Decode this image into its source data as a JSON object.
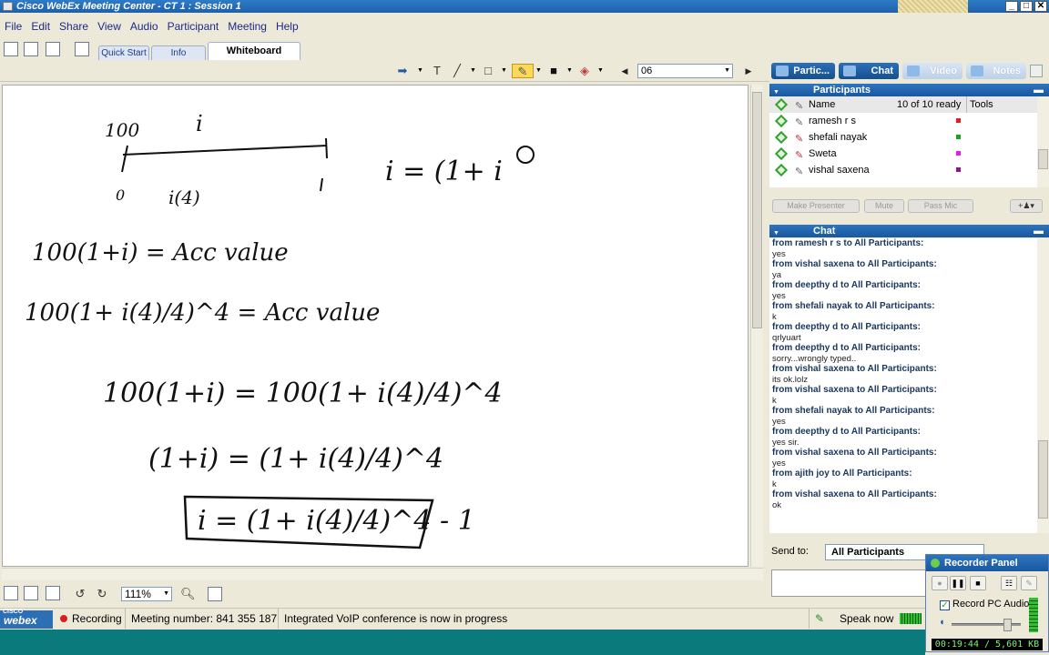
{
  "window": {
    "title": "Cisco WebEx Meeting Center - CT 1 : Session 1",
    "min_label": "_",
    "max_label": "□",
    "close_label": "✕"
  },
  "menu": [
    "File",
    "Edit",
    "Share",
    "View",
    "Audio",
    "Participant",
    "Meeting",
    "Help"
  ],
  "tabs": [
    "Quick Start",
    "Info",
    "Whiteboard"
  ],
  "annotation_toolbar": {
    "text_tool": "T",
    "page": "06"
  },
  "whiteboard": {
    "lines": [
      "100",
      "i",
      "0",
      "1",
      "i(4)",
      "i = (1+ i",
      "100(1+i) = Acc value",
      "100(1+ i(4)/4)^4 = Acc value",
      "100(1+i) = 100(1+ i(4)/4)^4",
      "(1+i) = (1+ i(4)/4)^4",
      "i = (1+ i(4)/4)^4 - 1"
    ]
  },
  "bottom_toolbar": {
    "zoom": "111%"
  },
  "panel_tabs": [
    "Partic...",
    "Chat",
    "Video",
    "Notes"
  ],
  "participants": {
    "header": "Participants",
    "columns": {
      "name": "Name",
      "ready": "10 of 10 ready",
      "tools": "Tools"
    },
    "rows": [
      {
        "name": "ramesh r s",
        "color": "#e02020"
      },
      {
        "name": "shefali nayak",
        "color": "#20a020"
      },
      {
        "name": "Sweta",
        "color": "#e020e0"
      },
      {
        "name": "vishal saxena",
        "color": "#8a1a8a"
      }
    ],
    "buttons": [
      "Make Presenter",
      "Mute",
      "Pass Mic"
    ]
  },
  "chat": {
    "header": "Chat",
    "messages": [
      {
        "from": "from ramesh r s to All Participants:",
        "text": "yes"
      },
      {
        "from": "from vishal saxena to All Participants:",
        "text": "ya"
      },
      {
        "from": "from deepthy d to All Participants:",
        "text": "yes"
      },
      {
        "from": "from shefali nayak to All Participants:",
        "text": "k"
      },
      {
        "from": "from deepthy d to All Participants:",
        "text": "qrlyuart"
      },
      {
        "from": "from deepthy d to All Participants:",
        "text": "sorry...wrongly typed.."
      },
      {
        "from": "from vishal saxena to All Participants:",
        "text": "its ok.lolz"
      },
      {
        "from": "from vishal saxena to All Participants:",
        "text": "k"
      },
      {
        "from": "from shefali nayak to All Participants:",
        "text": "yes"
      },
      {
        "from": "from deepthy d to All Participants:",
        "text": "yes sir."
      },
      {
        "from": "from vishal saxena to All Participants:",
        "text": "yes"
      },
      {
        "from": "from ajith joy to All Participants:",
        "text": "k"
      },
      {
        "from": "from vishal saxena to All Participants:",
        "text": "ok"
      }
    ],
    "send_to_label": "Send to:",
    "send_to_value": "All Participants"
  },
  "recorder": {
    "title": "Recorder Panel",
    "record_audio_label": "Record PC Audio",
    "status": "00:19:44 / 5,601 KB",
    "volume_fraction": 0.85
  },
  "statusbar": {
    "logo": "webex",
    "logo_vendor": "CISCO",
    "recording": "Recording",
    "meeting_number": "Meeting number: 841 355 187",
    "voip": "Integrated VoIP conference is now in progress",
    "speak": "Speak now"
  },
  "colors": {
    "title_bar": "#1f5fa8",
    "section_header": "#18589e",
    "chat_from": "#17365d",
    "taskbar": "#0a7a7c"
  }
}
